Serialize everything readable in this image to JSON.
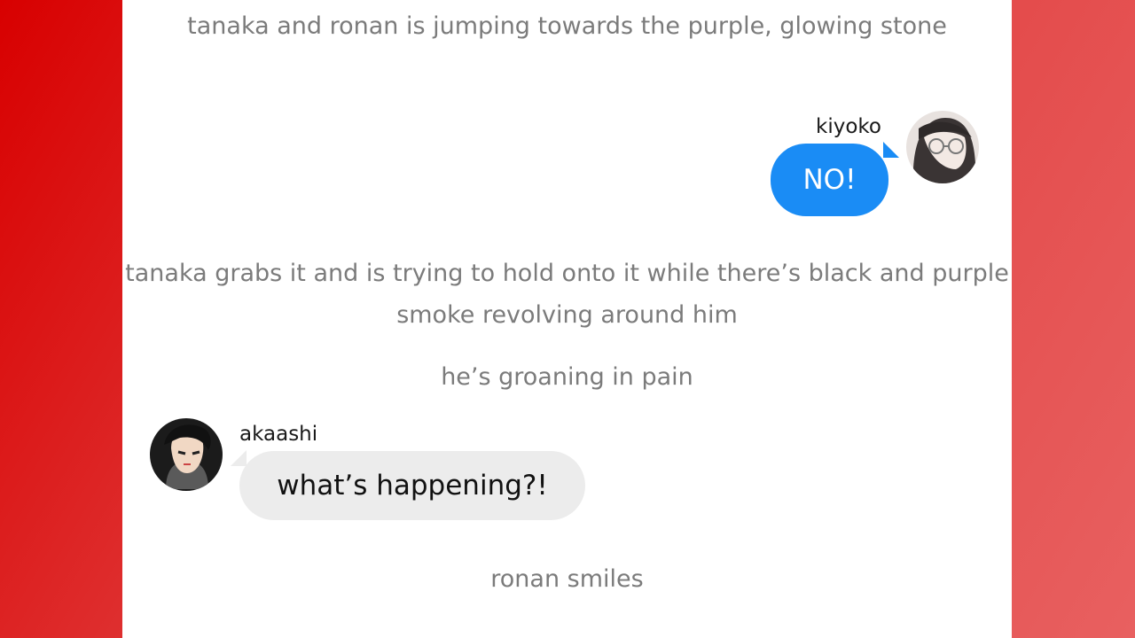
{
  "background_color": "#d80000",
  "messages": {
    "narration_1": "tanaka and ronan is jumping towards the purple, glowing stone",
    "kiyoko_name": "kiyoko",
    "kiyoko_text": "NO!",
    "narration_2": "tanaka grabs it and is trying to hold onto it while there’s black and purple smoke revolving around him",
    "narration_3": "he’s groaning in pain",
    "akaashi_name": "akaashi",
    "akaashi_text": "what’s happening?!",
    "narration_4": "ronan smiles"
  },
  "colors": {
    "sent_bubble": "#1a8cf5",
    "received_bubble": "#ececec",
    "narration_text": "#7b7b7b"
  }
}
